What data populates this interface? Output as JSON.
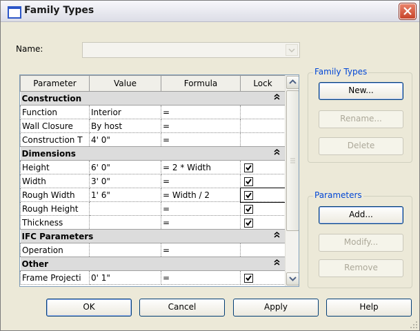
{
  "window": {
    "title": "Family Types"
  },
  "name_field": {
    "label": "Name:",
    "value": ""
  },
  "grid": {
    "columns": [
      "Parameter",
      "Value",
      "Formula",
      "Lock"
    ],
    "groups": [
      {
        "name": "Construction",
        "rows": [
          {
            "param": "Function",
            "value": "Interior",
            "formula": "=",
            "lock": null
          },
          {
            "param": "Wall Closure",
            "value": "By host",
            "formula": "=",
            "lock": null
          },
          {
            "param": "Construction T",
            "value": "4' 0\"",
            "formula": "=",
            "lock": null
          }
        ]
      },
      {
        "name": "Dimensions",
        "rows": [
          {
            "param": "Height",
            "value": "6'  0\"",
            "formula": "= 2 * Width",
            "lock": true
          },
          {
            "param": "Width",
            "value": "3'  0\"",
            "formula": "=",
            "lock": true
          },
          {
            "param": "Rough Width",
            "value": "1'  6\"",
            "formula": "= Width / 2",
            "lock": true
          },
          {
            "param": "Rough Height",
            "value": "",
            "formula": "=",
            "lock": true
          },
          {
            "param": "Thickness",
            "value": "",
            "formula": "=",
            "lock": true
          }
        ]
      },
      {
        "name": "IFC Parameters",
        "rows": [
          {
            "param": "Operation",
            "value": "",
            "formula": "=",
            "lock": null
          }
        ]
      },
      {
        "name": "Other",
        "rows": [
          {
            "param": "Frame Projecti",
            "value": "0'  1\"",
            "formula": "=",
            "lock": true
          }
        ]
      }
    ]
  },
  "family_types_box": {
    "title": "Family Types",
    "new_label": "New...",
    "rename_label": "Rename...",
    "delete_label": "Delete"
  },
  "parameters_box": {
    "title": "Parameters",
    "add_label": "Add...",
    "modify_label": "Modify...",
    "remove_label": "Remove"
  },
  "footer": {
    "ok_label": "OK",
    "cancel_label": "Cancel",
    "apply_label": "Apply",
    "help_label": "Help"
  }
}
